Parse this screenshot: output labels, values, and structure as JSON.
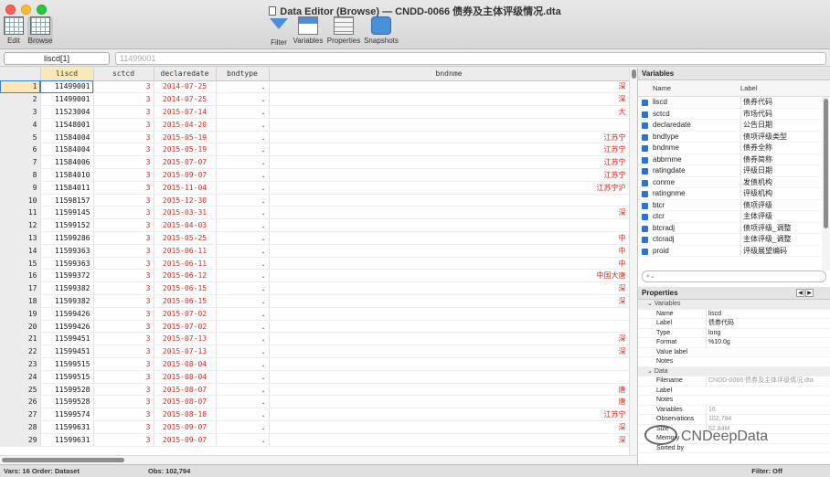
{
  "window": {
    "title": "Data Editor (Browse) — CNDD-0066 债券及主体评级情况.dta"
  },
  "toolbar": {
    "edit": "Edit",
    "browse": "Browse",
    "filter": "Filter",
    "variables": "Variables",
    "properties": "Properties",
    "snapshots": "Snapshots"
  },
  "filterbar": {
    "cellref": "liscd[1]",
    "cellvalue": "11499001"
  },
  "grid": {
    "columns": [
      "liscd",
      "sctcd",
      "declaredate",
      "bndtype",
      "bndnme"
    ],
    "rows": [
      {
        "n": "1",
        "liscd": "11499001",
        "sctcd": "3",
        "date": "2014-07-25",
        "type": ".",
        "nme": "深"
      },
      {
        "n": "2",
        "liscd": "11499001",
        "sctcd": "3",
        "date": "2014-07-25",
        "type": ".",
        "nme": "深"
      },
      {
        "n": "3",
        "liscd": "11523004",
        "sctcd": "3",
        "date": "2015-07-14",
        "type": ".",
        "nme": "大"
      },
      {
        "n": "4",
        "liscd": "11548001",
        "sctcd": "3",
        "date": "2015-04-20",
        "type": ".",
        "nme": ""
      },
      {
        "n": "5",
        "liscd": "11584004",
        "sctcd": "3",
        "date": "2015-05-19",
        "type": ".",
        "nme": "江苏宁"
      },
      {
        "n": "6",
        "liscd": "11584004",
        "sctcd": "3",
        "date": "2015-05-19",
        "type": ".",
        "nme": "江苏宁"
      },
      {
        "n": "7",
        "liscd": "11584006",
        "sctcd": "3",
        "date": "2015-07-07",
        "type": ".",
        "nme": "江苏宁"
      },
      {
        "n": "8",
        "liscd": "11584010",
        "sctcd": "3",
        "date": "2015-09-07",
        "type": ".",
        "nme": "江苏宁"
      },
      {
        "n": "9",
        "liscd": "11584011",
        "sctcd": "3",
        "date": "2015-11-04",
        "type": ".",
        "nme": "江苏宁沪"
      },
      {
        "n": "10",
        "liscd": "11598157",
        "sctcd": "3",
        "date": "2015-12-30",
        "type": ".",
        "nme": ""
      },
      {
        "n": "11",
        "liscd": "11599145",
        "sctcd": "3",
        "date": "2015-03-31",
        "type": ".",
        "nme": "深"
      },
      {
        "n": "12",
        "liscd": "11599152",
        "sctcd": "3",
        "date": "2015-04-03",
        "type": ".",
        "nme": ""
      },
      {
        "n": "13",
        "liscd": "11599286",
        "sctcd": "3",
        "date": "2015-05-25",
        "type": ".",
        "nme": "中"
      },
      {
        "n": "14",
        "liscd": "11599363",
        "sctcd": "3",
        "date": "2015-06-11",
        "type": ".",
        "nme": "中"
      },
      {
        "n": "15",
        "liscd": "11599363",
        "sctcd": "3",
        "date": "2015-06-11",
        "type": ".",
        "nme": "中"
      },
      {
        "n": "16",
        "liscd": "11599372",
        "sctcd": "3",
        "date": "2015-06-12",
        "type": ".",
        "nme": "中国大唐"
      },
      {
        "n": "17",
        "liscd": "11599382",
        "sctcd": "3",
        "date": "2015-06-15",
        "type": ".",
        "nme": "深"
      },
      {
        "n": "18",
        "liscd": "11599382",
        "sctcd": "3",
        "date": "2015-06-15",
        "type": ".",
        "nme": "深"
      },
      {
        "n": "19",
        "liscd": "11599426",
        "sctcd": "3",
        "date": "2015-07-02",
        "type": ".",
        "nme": ""
      },
      {
        "n": "20",
        "liscd": "11599426",
        "sctcd": "3",
        "date": "2015-07-02",
        "type": ".",
        "nme": ""
      },
      {
        "n": "21",
        "liscd": "11599451",
        "sctcd": "3",
        "date": "2015-07-13",
        "type": ".",
        "nme": "深"
      },
      {
        "n": "22",
        "liscd": "11599451",
        "sctcd": "3",
        "date": "2015-07-13",
        "type": ".",
        "nme": "深"
      },
      {
        "n": "23",
        "liscd": "11599515",
        "sctcd": "3",
        "date": "2015-08-04",
        "type": ".",
        "nme": ""
      },
      {
        "n": "24",
        "liscd": "11599515",
        "sctcd": "3",
        "date": "2015-08-04",
        "type": ".",
        "nme": ""
      },
      {
        "n": "25",
        "liscd": "11599528",
        "sctcd": "3",
        "date": "2015-08-07",
        "type": ".",
        "nme": "唐"
      },
      {
        "n": "26",
        "liscd": "11599528",
        "sctcd": "3",
        "date": "2015-08-07",
        "type": ".",
        "nme": "唐"
      },
      {
        "n": "27",
        "liscd": "11599574",
        "sctcd": "3",
        "date": "2015-08-18",
        "type": ".",
        "nme": "江苏宁"
      },
      {
        "n": "28",
        "liscd": "11599631",
        "sctcd": "3",
        "date": "2015-09-07",
        "type": ".",
        "nme": "深"
      },
      {
        "n": "29",
        "liscd": "11599631",
        "sctcd": "3",
        "date": "2015-09-07",
        "type": ".",
        "nme": "深"
      }
    ]
  },
  "variables_panel": {
    "title": "Variables",
    "col_name": "Name",
    "col_label": "Label",
    "items": [
      {
        "name": "liscd",
        "label": "债券代码"
      },
      {
        "name": "sctcd",
        "label": "市场代码"
      },
      {
        "name": "declaredate",
        "label": "公告日期"
      },
      {
        "name": "bndtype",
        "label": "债项评级类型"
      },
      {
        "name": "bndnme",
        "label": "债券全称"
      },
      {
        "name": "abbrnme",
        "label": "债券简称"
      },
      {
        "name": "ratingdate",
        "label": "评级日期"
      },
      {
        "name": "conme",
        "label": "发债机构"
      },
      {
        "name": "ratingnme",
        "label": "评级机构"
      },
      {
        "name": "btcr",
        "label": "债项评级"
      },
      {
        "name": "ctcr",
        "label": "主体评级"
      },
      {
        "name": "btcradj",
        "label": "债项评级_调整"
      },
      {
        "name": "ctcradj",
        "label": "主体评级_调整"
      },
      {
        "name": "proid",
        "label": "评级展望编码"
      }
    ]
  },
  "properties_panel": {
    "title": "Properties",
    "variables_section": "Variables",
    "var_props": [
      {
        "k": "Name",
        "v": "liscd"
      },
      {
        "k": "Label",
        "v": "债券代码"
      },
      {
        "k": "Type",
        "v": "long"
      },
      {
        "k": "Format",
        "v": "%10.0g"
      },
      {
        "k": "Value label",
        "v": ""
      },
      {
        "k": "Notes",
        "v": ""
      }
    ],
    "data_section": "Data",
    "data_props": [
      {
        "k": "Filename",
        "v": "CNDD-0066 债券及主体评级情况.dta"
      },
      {
        "k": "Label",
        "v": ""
      },
      {
        "k": "Notes",
        "v": ""
      },
      {
        "k": "Variables",
        "v": "16"
      },
      {
        "k": "Observations",
        "v": "102,794"
      },
      {
        "k": "Size",
        "v": "52.84M"
      },
      {
        "k": "Memory",
        "v": ""
      },
      {
        "k": "Sorted by",
        "v": ""
      }
    ]
  },
  "status": {
    "vars": "Vars: 16  Order: Dataset",
    "obs": "Obs: 102,794",
    "filter": "Filter: Off"
  },
  "watermark": "CNDeepData"
}
